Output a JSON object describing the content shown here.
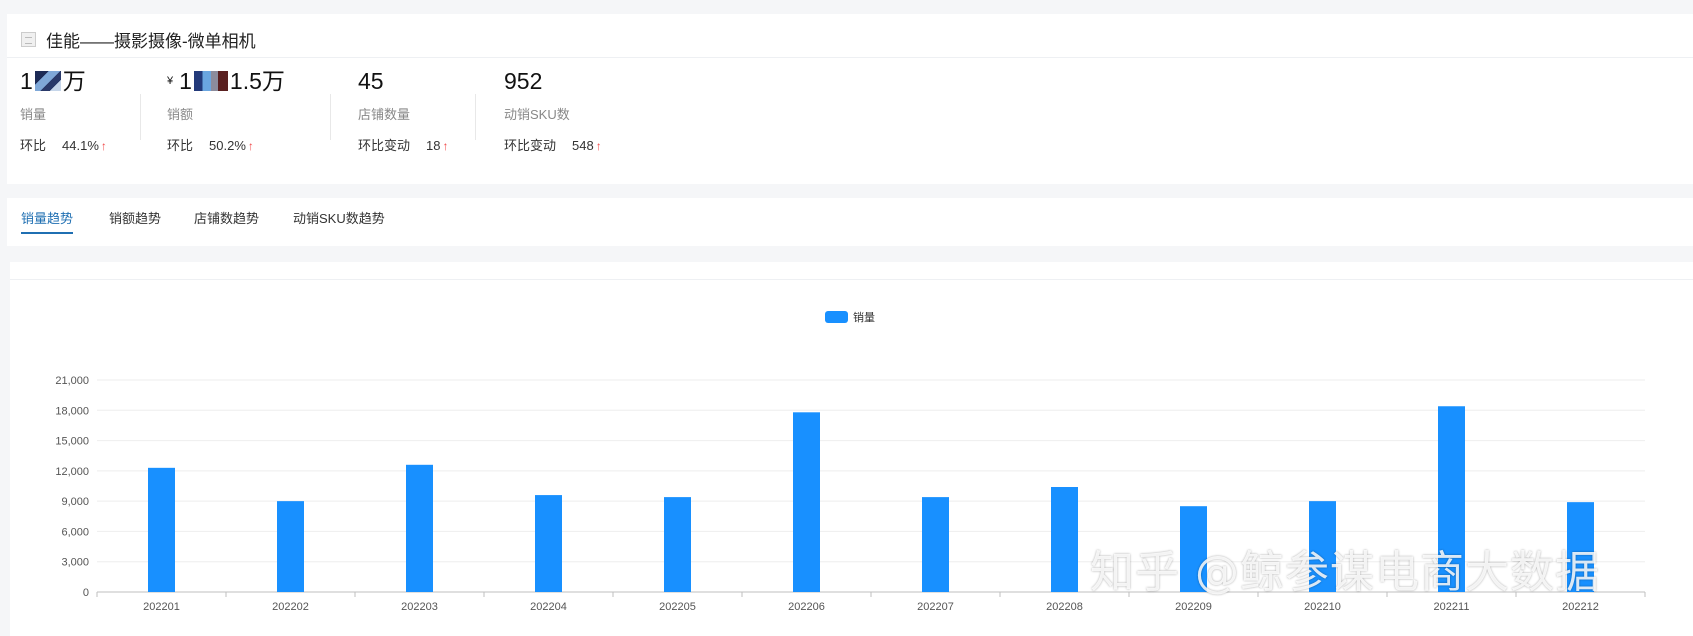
{
  "header": {
    "title": "佳能——摄影摄像-微单相机",
    "title_icon": "image-icon"
  },
  "metrics": [
    {
      "value_prefix": "1",
      "value_suffix": "万",
      "label": "销量",
      "change_label": "环比",
      "change_value": "44.1%",
      "trend": "up"
    },
    {
      "currency": "¥",
      "value_prefix": "1",
      "value_suffix": "1.5万",
      "label": "销额",
      "change_label": "环比",
      "change_value": "50.2%",
      "trend": "up"
    },
    {
      "value": "45",
      "label": "店铺数量",
      "change_label": "环比变动",
      "change_value": "18",
      "trend": "up"
    },
    {
      "value": "952",
      "label": "动销SKU数",
      "change_label": "环比变动",
      "change_value": "548",
      "trend": "up"
    }
  ],
  "tabs": [
    {
      "label": "销量趋势",
      "active": true
    },
    {
      "label": "销额趋势",
      "active": false
    },
    {
      "label": "店铺数趋势",
      "active": false
    },
    {
      "label": "动销SKU数趋势",
      "active": false
    }
  ],
  "chart_data": {
    "type": "bar",
    "categories": [
      "202201",
      "202202",
      "202203",
      "202204",
      "202205",
      "202206",
      "202207",
      "202208",
      "202209",
      "202210",
      "202211",
      "202212"
    ],
    "series": [
      {
        "name": "销量",
        "color": "#1890ff",
        "values": [
          12300,
          9000,
          12600,
          9600,
          9400,
          17800,
          9400,
          10400,
          8500,
          9000,
          18400,
          8900
        ]
      }
    ],
    "ylim": [
      0,
      21000
    ],
    "yticks": [
      0,
      3000,
      6000,
      9000,
      12000,
      15000,
      18000,
      21000
    ],
    "ytick_labels": [
      "0",
      "3,000",
      "6,000",
      "9,000",
      "12,000",
      "15,000",
      "18,000",
      "21,000"
    ],
    "legend_position": "top-center",
    "grid": true
  },
  "watermark": "知乎 @鲸参谋电商大数据",
  "colors": {
    "accent": "#1f6fb2",
    "bar": "#1890ff",
    "up_arrow": "#f04848"
  }
}
